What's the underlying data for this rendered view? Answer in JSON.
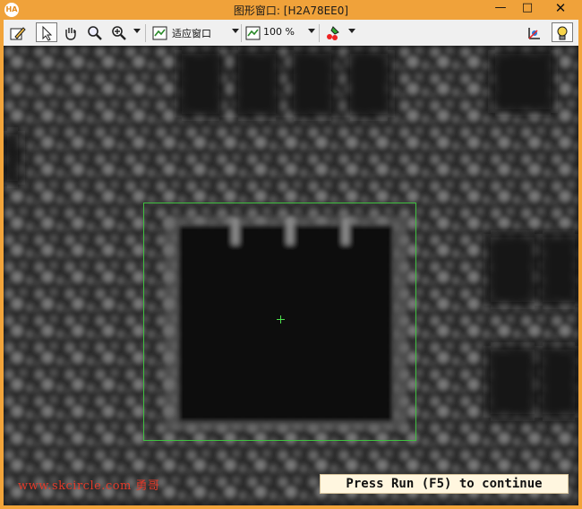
{
  "window": {
    "app_icon_text": "HA",
    "title": "图形窗口: [H2A78EE0]",
    "minimize_glyph": "—",
    "maximize_glyph": "□",
    "close_glyph": "✕"
  },
  "toolbar": {
    "tools": [
      "pencil-icon",
      "pointer-icon",
      "hand-icon",
      "magnifier-icon",
      "zoom-in-icon"
    ],
    "active_tool": "pointer-icon",
    "fit_mode": "适应窗口",
    "zoom": "100 %",
    "right_icons": [
      "color-tool-icon",
      "axis-icon",
      "lightbulb-icon"
    ]
  },
  "canvas": {
    "background": "#121212",
    "roi_color": "#3fbf3f",
    "crosshair_color": "#4ee04e"
  },
  "overlay": {
    "watermark": "www.skcircle.com 勇哥",
    "status_message": "Press Run (F5) to continue"
  }
}
